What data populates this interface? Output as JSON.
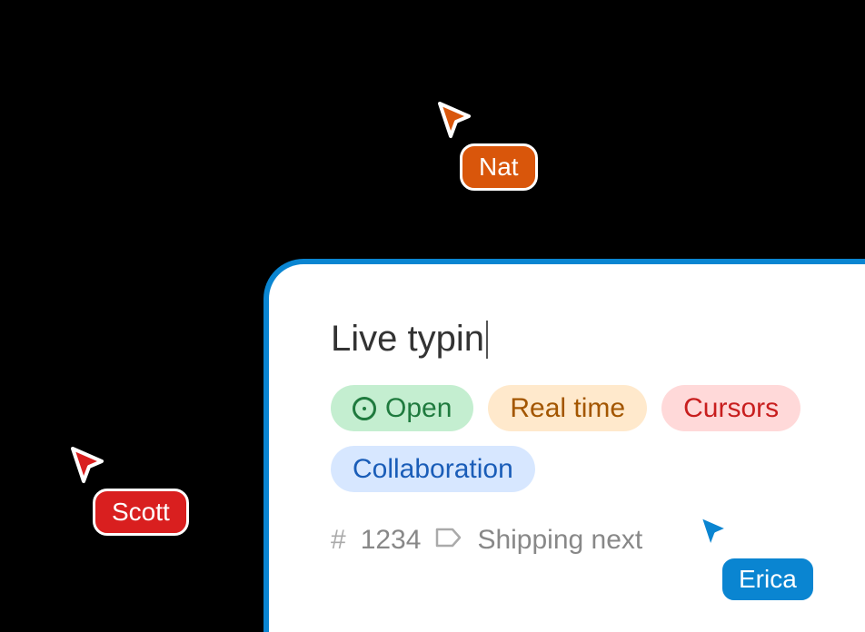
{
  "card": {
    "title": "Live typin",
    "status": {
      "label": "Open"
    },
    "tags": {
      "realtime": "Real time",
      "cursors": "Cursors",
      "collaboration": "Collaboration"
    },
    "meta": {
      "id": "1234",
      "milestone": "Shipping next"
    }
  },
  "presence": {
    "nat": {
      "name": "Nat",
      "color": "#d9560b"
    },
    "scott": {
      "name": "Scott",
      "color": "#d91f1f"
    },
    "erica": {
      "name": "Erica",
      "color": "#0a85d1"
    }
  }
}
